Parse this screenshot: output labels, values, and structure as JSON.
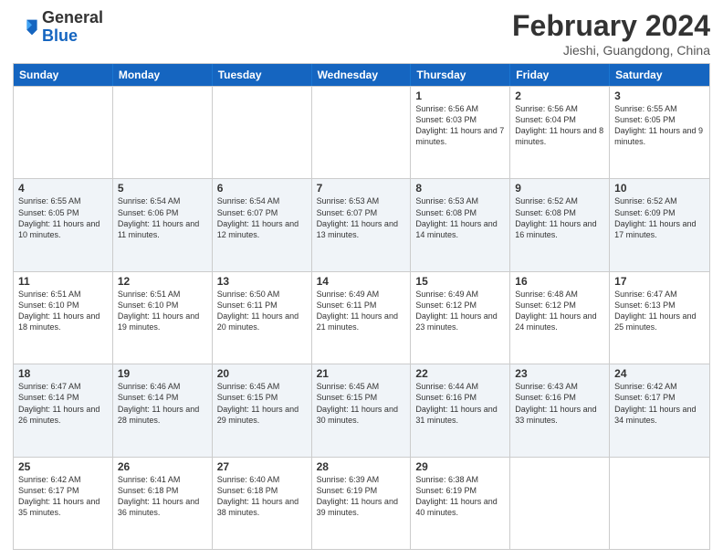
{
  "header": {
    "logo": {
      "general": "General",
      "blue": "Blue"
    },
    "title": "February 2024",
    "location": "Jieshi, Guangdong, China"
  },
  "days_of_week": [
    "Sunday",
    "Monday",
    "Tuesday",
    "Wednesday",
    "Thursday",
    "Friday",
    "Saturday"
  ],
  "weeks": [
    [
      {
        "day": "",
        "info": ""
      },
      {
        "day": "",
        "info": ""
      },
      {
        "day": "",
        "info": ""
      },
      {
        "day": "",
        "info": ""
      },
      {
        "day": "1",
        "info": "Sunrise: 6:56 AM\nSunset: 6:03 PM\nDaylight: 11 hours and 7 minutes."
      },
      {
        "day": "2",
        "info": "Sunrise: 6:56 AM\nSunset: 6:04 PM\nDaylight: 11 hours and 8 minutes."
      },
      {
        "day": "3",
        "info": "Sunrise: 6:55 AM\nSunset: 6:05 PM\nDaylight: 11 hours and 9 minutes."
      }
    ],
    [
      {
        "day": "4",
        "info": "Sunrise: 6:55 AM\nSunset: 6:05 PM\nDaylight: 11 hours and 10 minutes."
      },
      {
        "day": "5",
        "info": "Sunrise: 6:54 AM\nSunset: 6:06 PM\nDaylight: 11 hours and 11 minutes."
      },
      {
        "day": "6",
        "info": "Sunrise: 6:54 AM\nSunset: 6:07 PM\nDaylight: 11 hours and 12 minutes."
      },
      {
        "day": "7",
        "info": "Sunrise: 6:53 AM\nSunset: 6:07 PM\nDaylight: 11 hours and 13 minutes."
      },
      {
        "day": "8",
        "info": "Sunrise: 6:53 AM\nSunset: 6:08 PM\nDaylight: 11 hours and 14 minutes."
      },
      {
        "day": "9",
        "info": "Sunrise: 6:52 AM\nSunset: 6:08 PM\nDaylight: 11 hours and 16 minutes."
      },
      {
        "day": "10",
        "info": "Sunrise: 6:52 AM\nSunset: 6:09 PM\nDaylight: 11 hours and 17 minutes."
      }
    ],
    [
      {
        "day": "11",
        "info": "Sunrise: 6:51 AM\nSunset: 6:10 PM\nDaylight: 11 hours and 18 minutes."
      },
      {
        "day": "12",
        "info": "Sunrise: 6:51 AM\nSunset: 6:10 PM\nDaylight: 11 hours and 19 minutes."
      },
      {
        "day": "13",
        "info": "Sunrise: 6:50 AM\nSunset: 6:11 PM\nDaylight: 11 hours and 20 minutes."
      },
      {
        "day": "14",
        "info": "Sunrise: 6:49 AM\nSunset: 6:11 PM\nDaylight: 11 hours and 21 minutes."
      },
      {
        "day": "15",
        "info": "Sunrise: 6:49 AM\nSunset: 6:12 PM\nDaylight: 11 hours and 23 minutes."
      },
      {
        "day": "16",
        "info": "Sunrise: 6:48 AM\nSunset: 6:12 PM\nDaylight: 11 hours and 24 minutes."
      },
      {
        "day": "17",
        "info": "Sunrise: 6:47 AM\nSunset: 6:13 PM\nDaylight: 11 hours and 25 minutes."
      }
    ],
    [
      {
        "day": "18",
        "info": "Sunrise: 6:47 AM\nSunset: 6:14 PM\nDaylight: 11 hours and 26 minutes."
      },
      {
        "day": "19",
        "info": "Sunrise: 6:46 AM\nSunset: 6:14 PM\nDaylight: 11 hours and 28 minutes."
      },
      {
        "day": "20",
        "info": "Sunrise: 6:45 AM\nSunset: 6:15 PM\nDaylight: 11 hours and 29 minutes."
      },
      {
        "day": "21",
        "info": "Sunrise: 6:45 AM\nSunset: 6:15 PM\nDaylight: 11 hours and 30 minutes."
      },
      {
        "day": "22",
        "info": "Sunrise: 6:44 AM\nSunset: 6:16 PM\nDaylight: 11 hours and 31 minutes."
      },
      {
        "day": "23",
        "info": "Sunrise: 6:43 AM\nSunset: 6:16 PM\nDaylight: 11 hours and 33 minutes."
      },
      {
        "day": "24",
        "info": "Sunrise: 6:42 AM\nSunset: 6:17 PM\nDaylight: 11 hours and 34 minutes."
      }
    ],
    [
      {
        "day": "25",
        "info": "Sunrise: 6:42 AM\nSunset: 6:17 PM\nDaylight: 11 hours and 35 minutes."
      },
      {
        "day": "26",
        "info": "Sunrise: 6:41 AM\nSunset: 6:18 PM\nDaylight: 11 hours and 36 minutes."
      },
      {
        "day": "27",
        "info": "Sunrise: 6:40 AM\nSunset: 6:18 PM\nDaylight: 11 hours and 38 minutes."
      },
      {
        "day": "28",
        "info": "Sunrise: 6:39 AM\nSunset: 6:19 PM\nDaylight: 11 hours and 39 minutes."
      },
      {
        "day": "29",
        "info": "Sunrise: 6:38 AM\nSunset: 6:19 PM\nDaylight: 11 hours and 40 minutes."
      },
      {
        "day": "",
        "info": ""
      },
      {
        "day": "",
        "info": ""
      }
    ]
  ]
}
